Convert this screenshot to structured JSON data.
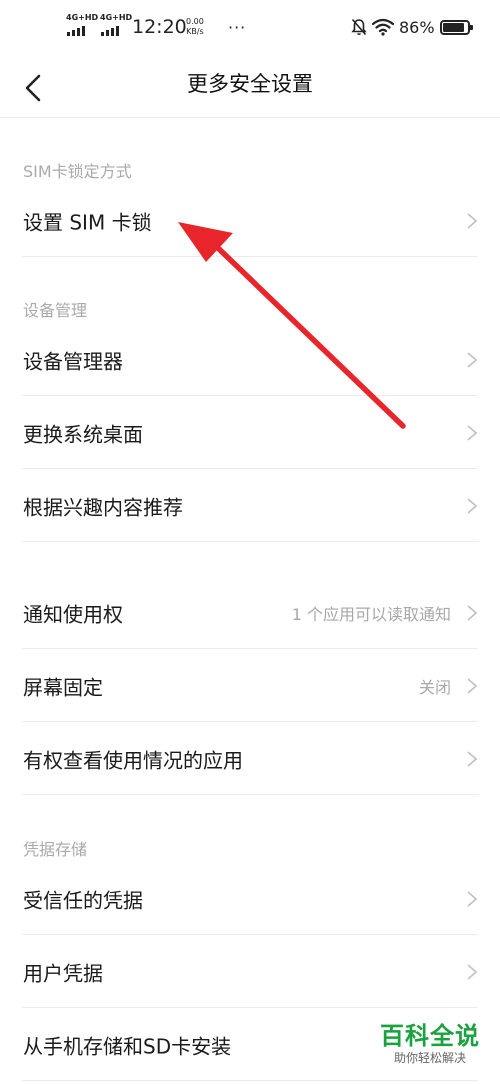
{
  "status_bar": {
    "net1": "4G+HD",
    "net2": "4G+HD",
    "time": "12:20",
    "speed_value": "0.00",
    "speed_unit": "KB/s",
    "dots": "···",
    "battery_text": "86%",
    "battery_level": 0.86
  },
  "header": {
    "title": "更多安全设置"
  },
  "sections": {
    "sim": {
      "header": "SIM卡锁定方式",
      "items": [
        {
          "label": "设置 SIM 卡锁"
        }
      ]
    },
    "device": {
      "header": "设备管理",
      "items": [
        {
          "label": "设备管理器"
        },
        {
          "label": "更换系统桌面"
        },
        {
          "label": "根据兴趣内容推荐"
        }
      ]
    },
    "misc": {
      "items": [
        {
          "label": "通知使用权",
          "value": "1 个应用可以读取通知"
        },
        {
          "label": "屏幕固定",
          "value": "关闭"
        },
        {
          "label": "有权查看使用情况的应用"
        }
      ]
    },
    "credentials": {
      "header": "凭据存储",
      "items": [
        {
          "label": "受信任的凭据"
        },
        {
          "label": "用户凭据"
        },
        {
          "label": "从手机存储和SD卡安装"
        }
      ]
    }
  },
  "watermark": {
    "title": "百科全说",
    "subtitle": "助你轻松解决"
  },
  "colors": {
    "annotation_arrow": "#e8252a",
    "watermark_green": "#1aa23e"
  }
}
